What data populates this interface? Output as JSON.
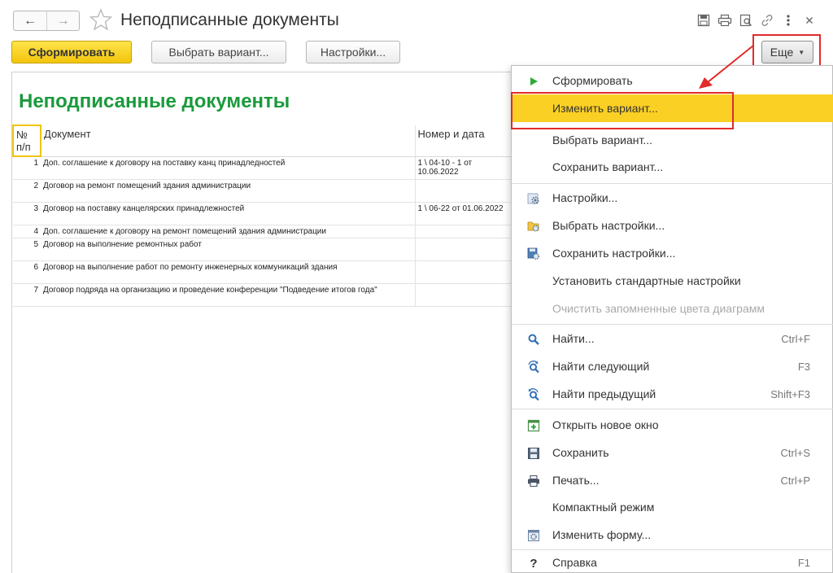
{
  "window": {
    "title": "Неподписанные документы"
  },
  "toolbar": {
    "generate_label": "Сформировать",
    "choose_variant_label": "Выбрать вариант...",
    "settings_label": "Настройки...",
    "more_label": "Еще"
  },
  "report": {
    "title": "Неподписанные документы",
    "columns": [
      "№ п/п",
      "Документ",
      "Номер и дата"
    ],
    "rows": [
      {
        "num": "1",
        "doc": "Доп. соглашение к договору на поставку канц принадледностей",
        "number_date": "1 \\ 04-10 - 1 от 10.06.2022"
      },
      {
        "num": "2",
        "doc": "Договор на ремонт помещений здания администрации",
        "number_date": ""
      },
      {
        "num": "3",
        "doc": "Договор на поставку канцелярских принадлежностей",
        "number_date": "1 \\ 06-22 от 01.06.2022"
      },
      {
        "num": "4",
        "doc": "Доп. соглашение к договору на ремонт помещений здания администрации",
        "number_date": ""
      },
      {
        "num": "5",
        "doc": "Договор на выполнение ремонтных работ",
        "number_date": ""
      },
      {
        "num": "6",
        "doc": "Договор  на  выполнение работ по ремонту инженерных коммуникаций здания",
        "number_date": ""
      },
      {
        "num": "7",
        "doc": "Договор подряда на организацию и проведение конференции \"Подведение итогов года\"",
        "number_date": ""
      }
    ]
  },
  "menu": {
    "items": [
      {
        "label": "Сформировать",
        "shortcut": "",
        "icon": "play-icon"
      },
      {
        "label": "Изменить вариант...",
        "shortcut": "",
        "icon": ""
      },
      {
        "label": "Выбрать вариант...",
        "shortcut": "",
        "icon": ""
      },
      {
        "label": "Сохранить вариант...",
        "shortcut": "",
        "icon": ""
      },
      {
        "label": "Настройки...",
        "shortcut": "",
        "icon": "settings-gear-icon"
      },
      {
        "label": "Выбрать настройки...",
        "shortcut": "",
        "icon": "folder-gear-icon"
      },
      {
        "label": "Сохранить настройки...",
        "shortcut": "",
        "icon": "save-gear-icon"
      },
      {
        "label": "Установить стандартные настройки",
        "shortcut": "",
        "icon": ""
      },
      {
        "label": "Очистить запомненные цвета диаграмм",
        "shortcut": "",
        "icon": ""
      },
      {
        "label": "Найти...",
        "shortcut": "Ctrl+F",
        "icon": "search-icon"
      },
      {
        "label": "Найти следующий",
        "shortcut": "F3",
        "icon": "find-next-icon"
      },
      {
        "label": "Найти предыдущий",
        "shortcut": "Shift+F3",
        "icon": "find-previous-icon"
      },
      {
        "label": "Открыть новое окно",
        "shortcut": "",
        "icon": "new-window-icon"
      },
      {
        "label": "Сохранить",
        "shortcut": "Ctrl+S",
        "icon": "floppy-icon"
      },
      {
        "label": "Печать...",
        "shortcut": "Ctrl+P",
        "icon": "printer-icon"
      },
      {
        "label": "Компактный режим",
        "shortcut": "",
        "icon": ""
      },
      {
        "label": "Изменить форму...",
        "shortcut": "",
        "icon": "form-settings-icon"
      },
      {
        "label": "Справка",
        "shortcut": "F1",
        "icon": "help-icon"
      }
    ]
  },
  "colors": {
    "primary_button": "#f2c40c",
    "report_title": "#1a9a3c",
    "menu_selected": "#fbd024",
    "annotation_red": "#e12b2b",
    "icon_blue": "#2f6fb5"
  }
}
